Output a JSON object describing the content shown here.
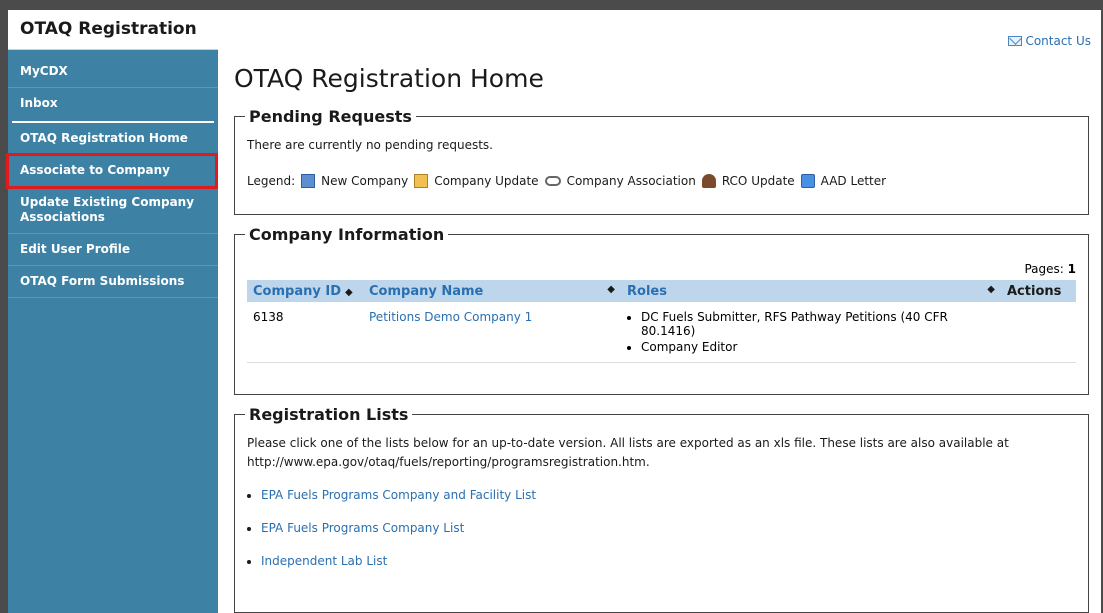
{
  "header": {
    "app_title": "OTAQ Registration",
    "contact_label": "Contact Us"
  },
  "sidebar": {
    "items": [
      {
        "label": "MyCDX"
      },
      {
        "label": "Inbox"
      },
      {
        "label": "OTAQ Registration Home"
      },
      {
        "label": "Associate to Company",
        "highlighted": true
      },
      {
        "label": "Update Existing Company Associations"
      },
      {
        "label": "Edit User Profile"
      },
      {
        "label": "OTAQ Form Submissions"
      }
    ]
  },
  "main": {
    "title": "OTAQ Registration Home",
    "pending": {
      "legend": "Pending Requests",
      "message": "There are currently no pending requests.",
      "legend_label": "Legend:",
      "legend_items": [
        {
          "icon": "new-company-icon",
          "label": "New Company"
        },
        {
          "icon": "company-update-icon",
          "label": "Company Update"
        },
        {
          "icon": "company-association-icon",
          "label": "Company Association"
        },
        {
          "icon": "rco-update-icon",
          "label": "RCO Update"
        },
        {
          "icon": "aad-letter-icon",
          "label": "AAD Letter"
        }
      ]
    },
    "company_info": {
      "legend": "Company Information",
      "pages_label": "Pages:",
      "pages_value": "1",
      "columns": [
        "Company ID",
        "Company Name",
        "Roles",
        "Actions"
      ],
      "rows": [
        {
          "company_id": "6138",
          "company_name": "Petitions Demo Company 1",
          "roles": [
            "DC Fuels Submitter, RFS Pathway Petitions (40 CFR 80.1416)",
            "Company Editor"
          ],
          "actions": ""
        }
      ]
    },
    "registration_lists": {
      "legend": "Registration Lists",
      "intro": "Please click one of the lists below for an up-to-date version. All lists are exported as an xls file. These lists are also available at http://www.epa.gov/otaq/fuels/reporting/programsregistration.htm.",
      "links": [
        "EPA Fuels Programs Company and Facility List",
        "EPA Fuels Programs Company List",
        "Independent Lab List"
      ]
    }
  },
  "colors": {
    "sidebar_bg": "#3d82a5",
    "table_header_bg": "#bed6ec",
    "link": "#2a6fb0",
    "highlight_outline": "#e01b1b"
  }
}
